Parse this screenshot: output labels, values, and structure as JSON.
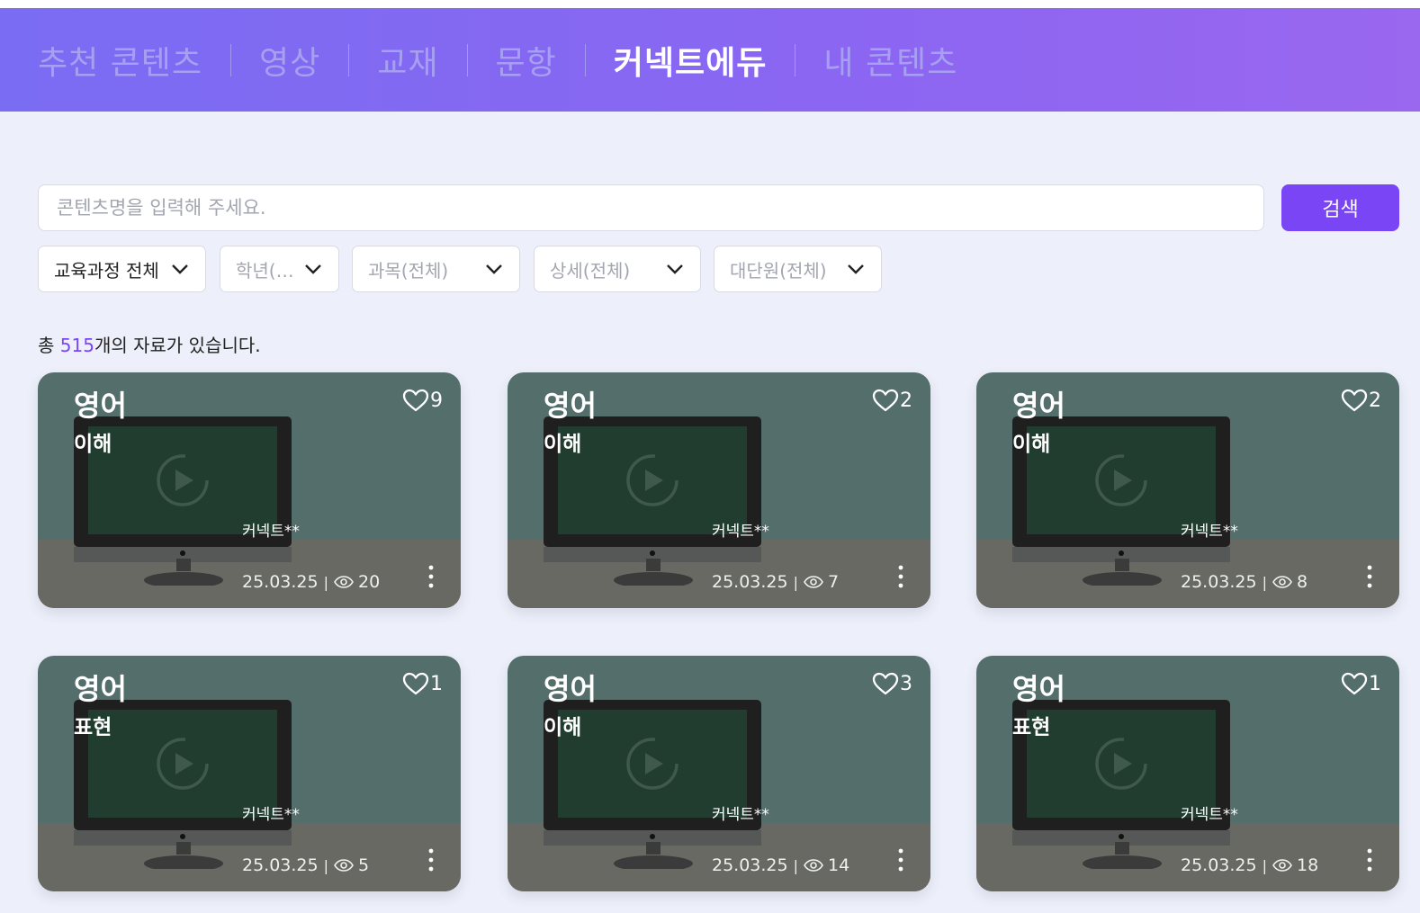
{
  "nav": {
    "items": [
      {
        "label": "추천 콘텐츠",
        "active": false
      },
      {
        "label": "영상",
        "active": false
      },
      {
        "label": "교재",
        "active": false
      },
      {
        "label": "문항",
        "active": false
      },
      {
        "label": "커넥트에듀",
        "active": true
      },
      {
        "label": "내 콘텐츠",
        "active": false
      }
    ]
  },
  "search": {
    "placeholder": "콘텐츠명을 입력해 주세요.",
    "value": "",
    "button_label": "검색"
  },
  "filters": [
    {
      "label": "교육과정 전체",
      "selected": true
    },
    {
      "label": "학년(…",
      "selected": false
    },
    {
      "label": "과목(전체)",
      "selected": false
    },
    {
      "label": "상세(전체)",
      "selected": false
    },
    {
      "label": "대단원(전체)",
      "selected": false
    }
  ],
  "results": {
    "prefix": "총 ",
    "count": "515",
    "suffix": "개의 자료가 있습니다."
  },
  "cards": [
    {
      "subject": "영어",
      "category": "이해",
      "likes": "9",
      "author": "커넥트**",
      "date": "25.03.25",
      "views": "20"
    },
    {
      "subject": "영어",
      "category": "이해",
      "likes": "2",
      "author": "커넥트**",
      "date": "25.03.25",
      "views": "7"
    },
    {
      "subject": "영어",
      "category": "이해",
      "likes": "2",
      "author": "커넥트**",
      "date": "25.03.25",
      "views": "8"
    },
    {
      "subject": "영어",
      "category": "표현",
      "likes": "1",
      "author": "커넥트**",
      "date": "25.03.25",
      "views": "5"
    },
    {
      "subject": "영어",
      "category": "이해",
      "likes": "3",
      "author": "커넥트**",
      "date": "25.03.25",
      "views": "14"
    },
    {
      "subject": "영어",
      "category": "표현",
      "likes": "1",
      "author": "커넥트**",
      "date": "25.03.25",
      "views": "18"
    }
  ],
  "colors": {
    "accent": "#7a45f5",
    "header_start": "#7a6cf3",
    "header_end": "#9a67ef",
    "page_bg": "#edf0fa",
    "card_wall": "#546e6c",
    "card_floor": "#676962",
    "screen": "#213d30"
  },
  "icons": {
    "filter_chevron": "chevron-down-icon",
    "like": "heart-outline-icon",
    "views": "eye-icon",
    "more": "vertical-dots-icon",
    "thumbnail": "monitor-play-icon"
  }
}
